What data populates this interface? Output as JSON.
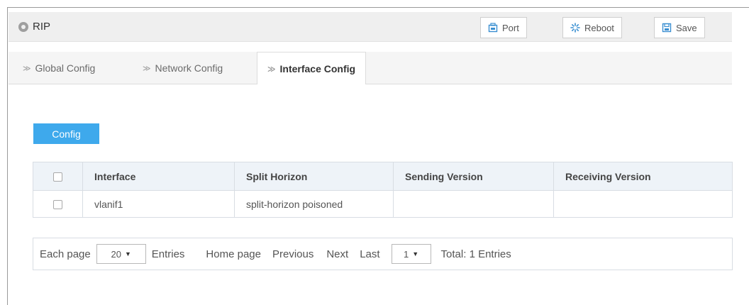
{
  "header": {
    "title": "RIP",
    "buttons": {
      "port": "Port",
      "reboot": "Reboot",
      "save": "Save"
    }
  },
  "tabs": [
    {
      "label": "Global Config"
    },
    {
      "label": "Network Config"
    },
    {
      "label": "Interface Config"
    }
  ],
  "config_button": "Config",
  "table": {
    "columns": [
      "Interface",
      "Split Horizon",
      "Sending Version",
      "Receiving Version"
    ],
    "rows": [
      {
        "interface": "vlanif1",
        "split_horizon": "split-horizon poisoned",
        "sending_version": "",
        "receiving_version": ""
      }
    ]
  },
  "pager": {
    "each_page_label": "Each page",
    "page_size": "20",
    "entries_label": "Entries",
    "home": "Home page",
    "previous": "Previous",
    "next": "Next",
    "last": "Last",
    "current_page": "1",
    "total": "Total: 1 Entries"
  },
  "colors": {
    "accent": "#3ea9ec",
    "header_bg": "#efefef",
    "table_header_bg": "#eef3f8"
  },
  "icons": [
    "location-pin-icon",
    "port-icon",
    "reboot-icon",
    "save-icon",
    "tab-arrow-icon",
    "dropdown-caret-icon"
  ]
}
